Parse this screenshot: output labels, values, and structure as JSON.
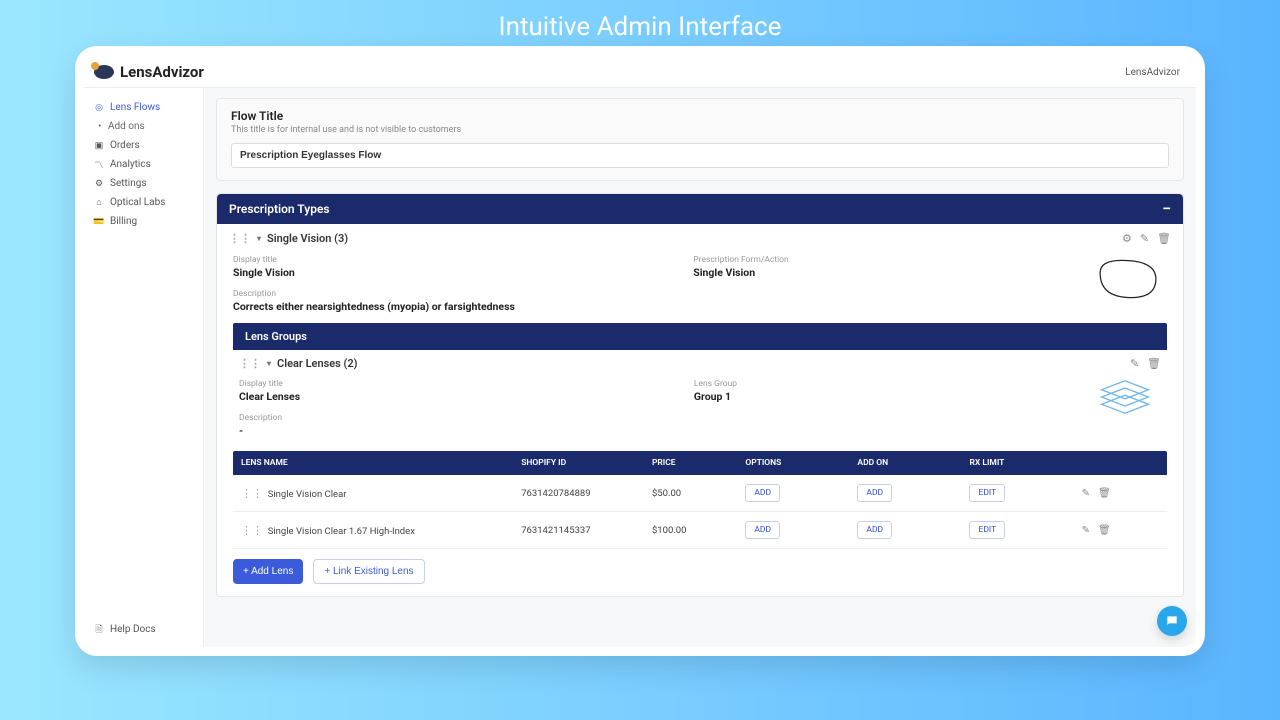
{
  "promo": {
    "title": "Intuitive Admin Interface"
  },
  "brand": {
    "name": "LensAdvizor",
    "text_right": "LensAdvizor"
  },
  "sidebar": {
    "items": [
      {
        "label": "Lens Flows",
        "active": true
      },
      {
        "label": "Add ons",
        "sub": true
      },
      {
        "label": "Orders"
      },
      {
        "label": "Analytics"
      },
      {
        "label": "Settings"
      },
      {
        "label": "Optical Labs"
      },
      {
        "label": "Billing"
      }
    ],
    "help": "Help Docs"
  },
  "flow": {
    "title_label": "Flow Title",
    "subtitle": "This title is for internal use and is not visible to customers",
    "value": "Prescription Eyeglasses Flow"
  },
  "prescription_types": {
    "header": "Prescription Types",
    "item": {
      "name": "Single Vision (3)",
      "display_title_label": "Display title",
      "display_title": "Single Vision",
      "form_label": "Prescription Form/Action",
      "form_value": "Single Vision",
      "desc_label": "Description",
      "desc_value": "Corrects either nearsightedness (myopia) or farsightedness"
    }
  },
  "lens_groups": {
    "header": "Lens Groups",
    "item": {
      "name": "Clear Lenses (2)",
      "display_title_label": "Display title",
      "display_title": "Clear Lenses",
      "group_label": "Lens Group",
      "group_value": "Group 1",
      "desc_label": "Description",
      "desc_value": "-"
    },
    "table": {
      "columns": [
        "LENS NAME",
        "SHOPIFY ID",
        "PRICE",
        "OPTIONS",
        "ADD ON",
        "RX LIMIT",
        ""
      ],
      "rows": [
        {
          "name": "Single Vision Clear",
          "shopify": "7631420784889",
          "price": "$50.00",
          "options": "ADD",
          "addon": "ADD",
          "rx": "EDIT"
        },
        {
          "name": "Single Vision Clear 1.67 High-Index",
          "shopify": "7631421145337",
          "price": "$100.00",
          "options": "ADD",
          "addon": "ADD",
          "rx": "EDIT"
        }
      ]
    },
    "buttons": {
      "add": "+ Add Lens",
      "link": "+ Link Existing Lens"
    }
  }
}
